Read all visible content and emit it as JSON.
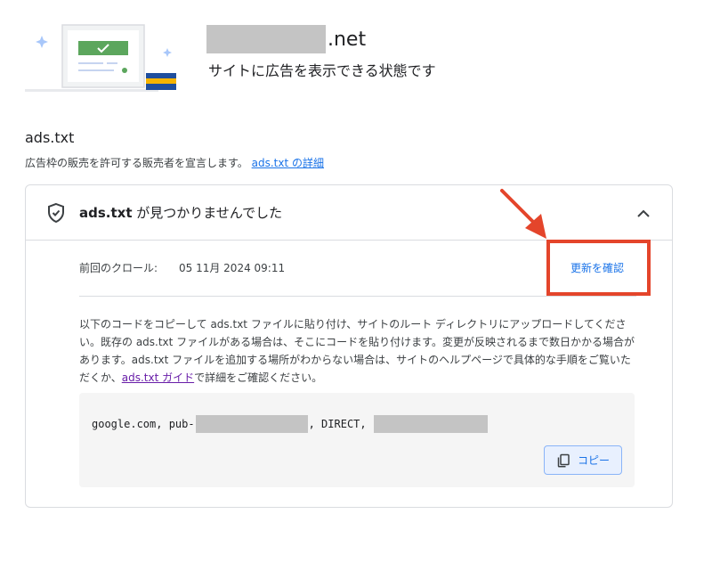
{
  "header": {
    "site_suffix": ".net",
    "status_text": "サイトに広告を表示できる状態です"
  },
  "section": {
    "title": "ads.txt",
    "description": "広告枠の販売を許可する販売者を宣言します。",
    "details_link": "ads.txt の詳細"
  },
  "card": {
    "title_bold": "ads.txt",
    "title_rest": " が見つかりませんでした",
    "crawl_label": "前回のクロール:",
    "crawl_value": "05 11月 2024 09:11",
    "refresh_link": "更新を確認",
    "instructions_before": "以下のコードをコピーして ads.txt ファイルに貼り付け、サイトのルート ディレクトリにアップロードしてください。既存の ads.txt ファイルがある場合は、そこにコードを貼り付けます。変更が反映されるまで数日かかる場合があります。ads.txt ファイルを追加する場所がわからない場合は、サイトのヘルプページで具体的な手順をご覧いただくか、",
    "instructions_link": "ads.txt ガイド",
    "instructions_after": "で詳細をご確認ください。",
    "code_prefix": "google.com, pub-",
    "code_middle": ", DIRECT,",
    "copy_label": "コピー"
  },
  "icons": {
    "shield": "shield-check-icon",
    "chevron": "chevron-up-icon",
    "copy": "copy-icon"
  },
  "colors": {
    "link": "#1a73e8",
    "visited_link": "#681da8",
    "annotation": "#e4452b",
    "check_green": "#5ca65d"
  }
}
